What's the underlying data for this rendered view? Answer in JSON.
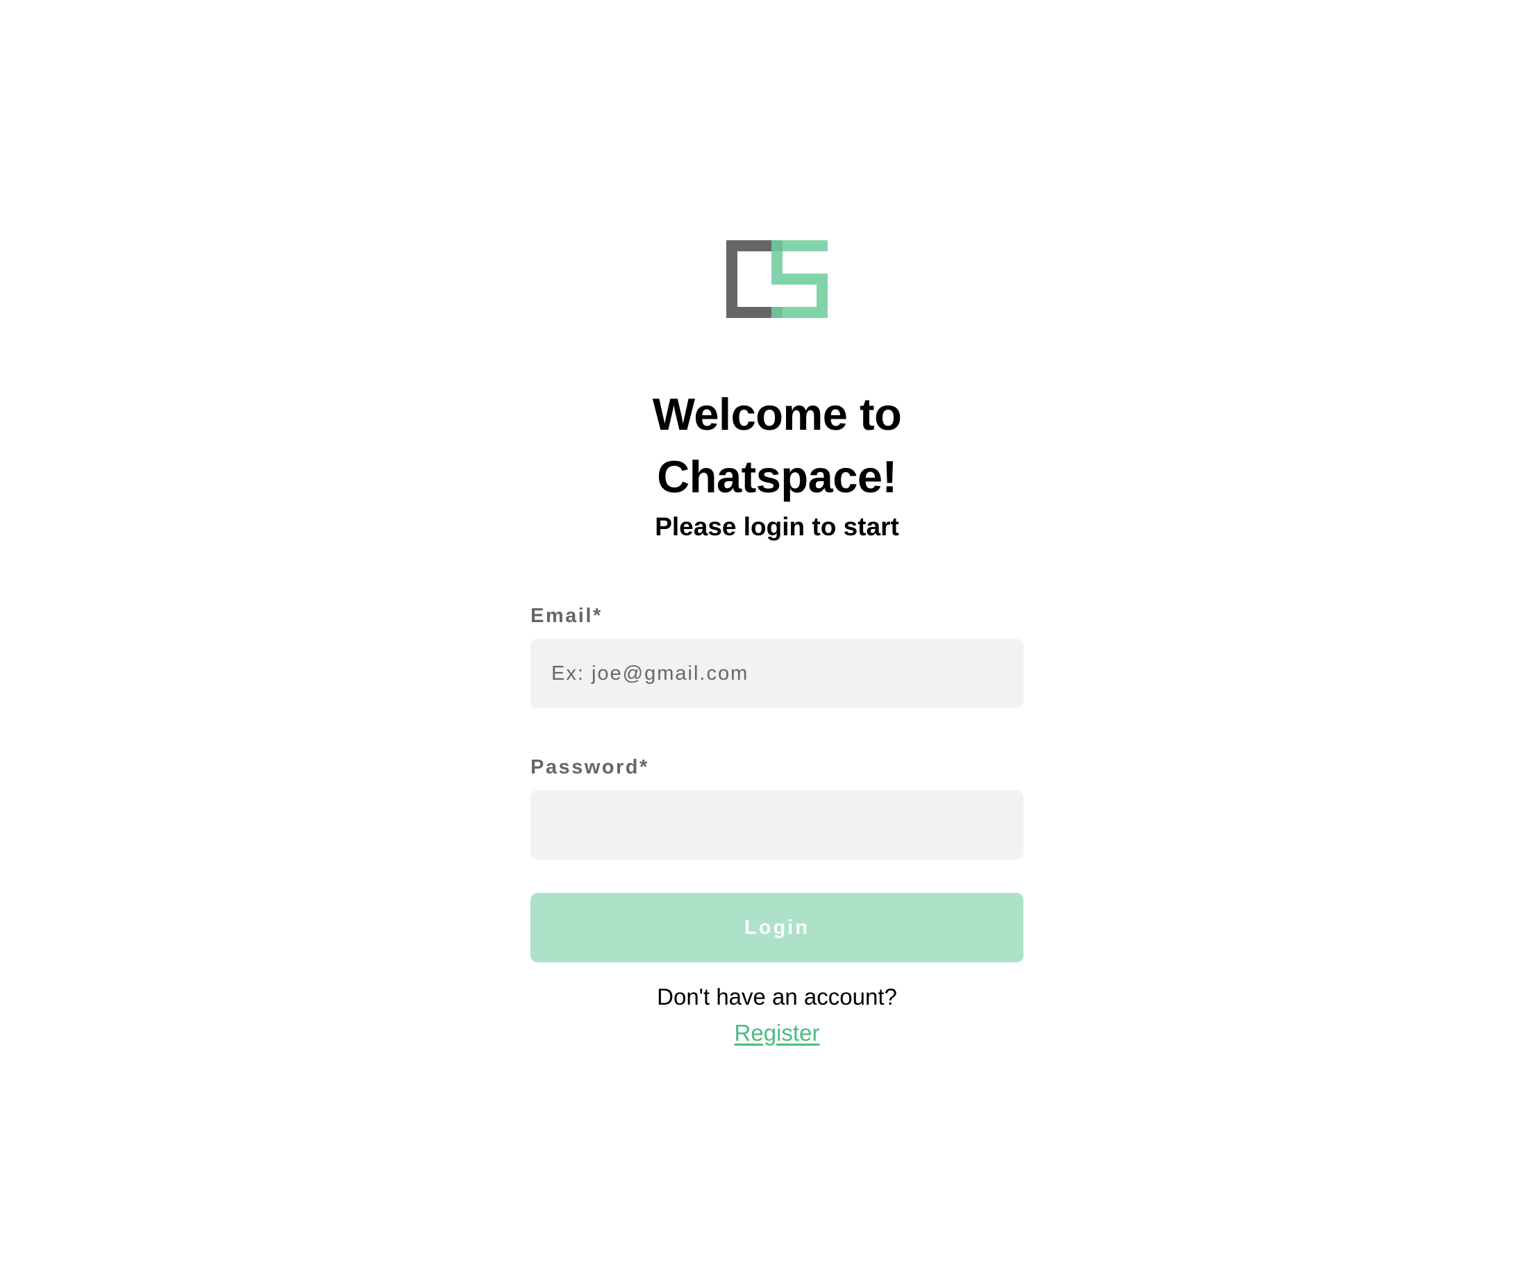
{
  "brand": {
    "logo_icon": "chatspace-cs-logo-icon",
    "dark_color": "#666666",
    "accent_color": "#82d3ac"
  },
  "header": {
    "title": "Welcome to Chatspace!",
    "subtitle": "Please login to start"
  },
  "form": {
    "email": {
      "label": "Email*",
      "placeholder": "Ex: joe@gmail.com",
      "value": ""
    },
    "password": {
      "label": "Password*",
      "placeholder": "",
      "value": ""
    },
    "login_label": "Login",
    "login_color": "#ade2c8"
  },
  "footer": {
    "account_prompt": "Don't have an account?",
    "register_label": "Register",
    "register_color": "#4cba84"
  }
}
